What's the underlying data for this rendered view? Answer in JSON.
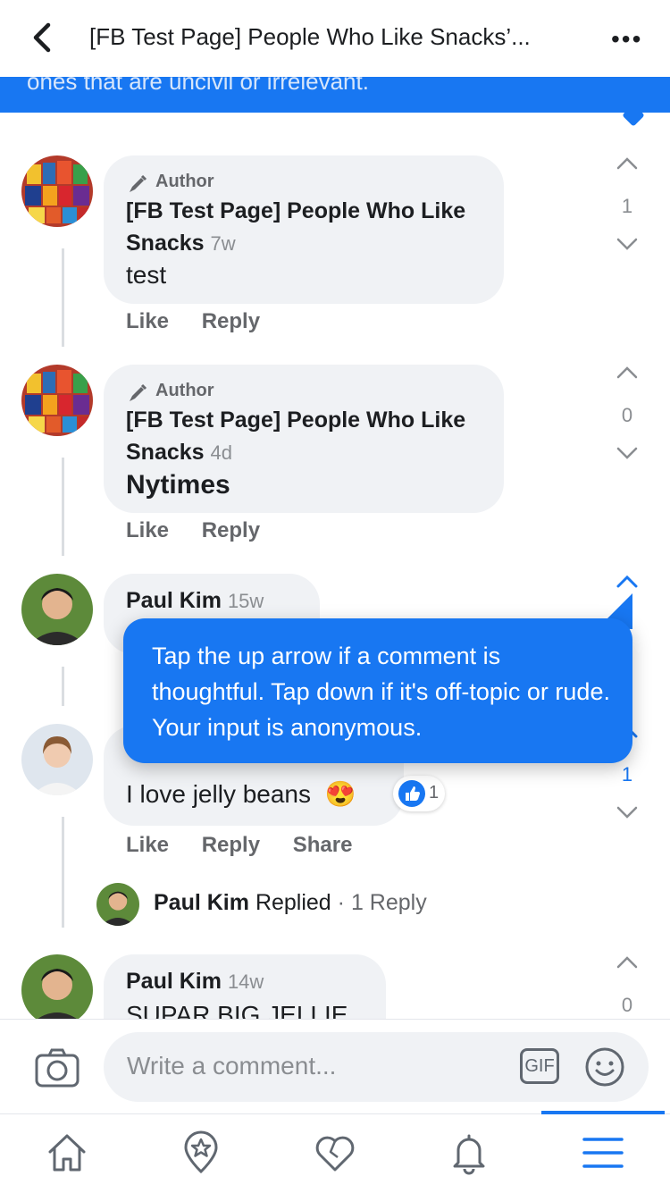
{
  "header": {
    "title": "[FB Test Page] People Who Like Snacks’...",
    "more_label": "•••"
  },
  "banner": {
    "text": "ones that are uncivil or irrelevant."
  },
  "comments": [
    {
      "badge": "Author",
      "name": "[FB Test Page] People Who Like Snacks",
      "time": "7w",
      "text": "test",
      "actions": [
        "Like",
        "Reply"
      ],
      "vote_count": "1"
    },
    {
      "badge": "Author",
      "name": "[FB Test Page] People Who Like Snacks",
      "time": "4d",
      "text": "Nytimes",
      "actions": [
        "Like",
        "Reply"
      ],
      "vote_count": "0"
    },
    {
      "name": "Paul Kim",
      "time": "15w"
    },
    {
      "text": "I love jelly beans",
      "emoji": "😍",
      "reaction_count": "1",
      "actions": [
        "Like",
        "Reply",
        "Share"
      ],
      "vote_count": "1",
      "reply_summary": {
        "name": "Paul Kim",
        "verb": "Replied",
        "count": "· 1 Reply"
      }
    },
    {
      "name": "Paul Kim",
      "time": "14w",
      "text": "SUPAR BIG JELLIE",
      "vote_count": "0"
    }
  ],
  "tooltip": {
    "text": "Tap the up arrow if a comment is thoughtful. Tap down if it's off-topic or rude. Your input  is anonymous."
  },
  "composer": {
    "placeholder": "Write a comment...",
    "gif_label": "GIF"
  },
  "tabs": [
    {
      "icon": "home-icon"
    },
    {
      "icon": "pages-icon"
    },
    {
      "icon": "dating-icon"
    },
    {
      "icon": "notifications-icon"
    },
    {
      "icon": "menu-icon",
      "active": true
    }
  ],
  "colors": {
    "accent": "#1877f2",
    "bubble": "#f0f2f5",
    "muted": "#65676b"
  }
}
